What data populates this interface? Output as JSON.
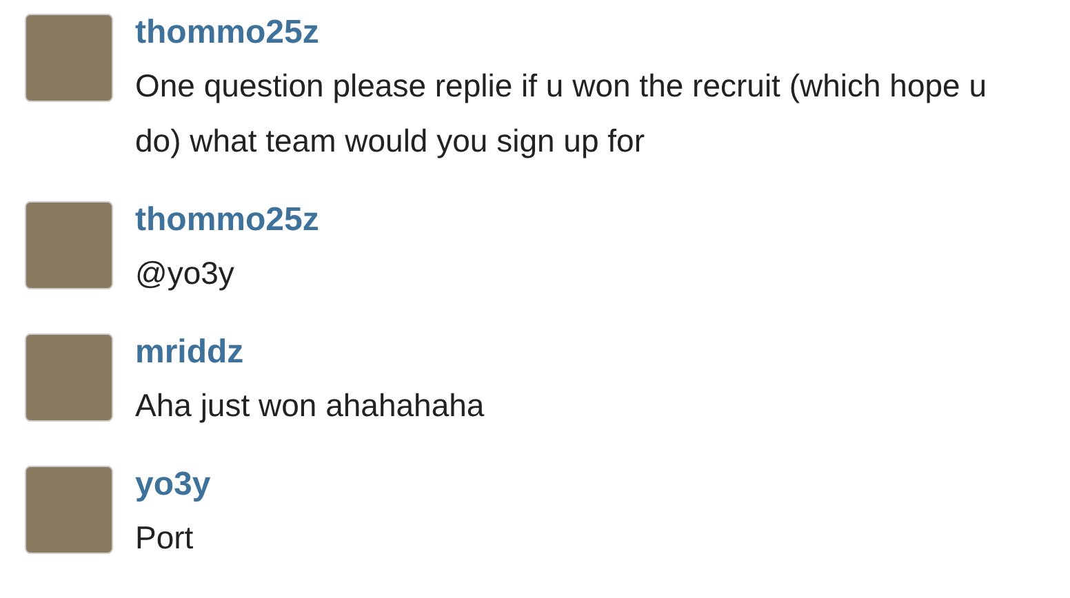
{
  "comments": [
    {
      "username": "thommo25z",
      "text": "One question please replie if u won the recruit (which hope u do) what team would you sign up for"
    },
    {
      "username": "thommo25z",
      "text": "@yo3y"
    },
    {
      "username": "mriddz",
      "text": "Aha just won ahahahaha"
    },
    {
      "username": "yo3y",
      "text": "Port"
    }
  ]
}
